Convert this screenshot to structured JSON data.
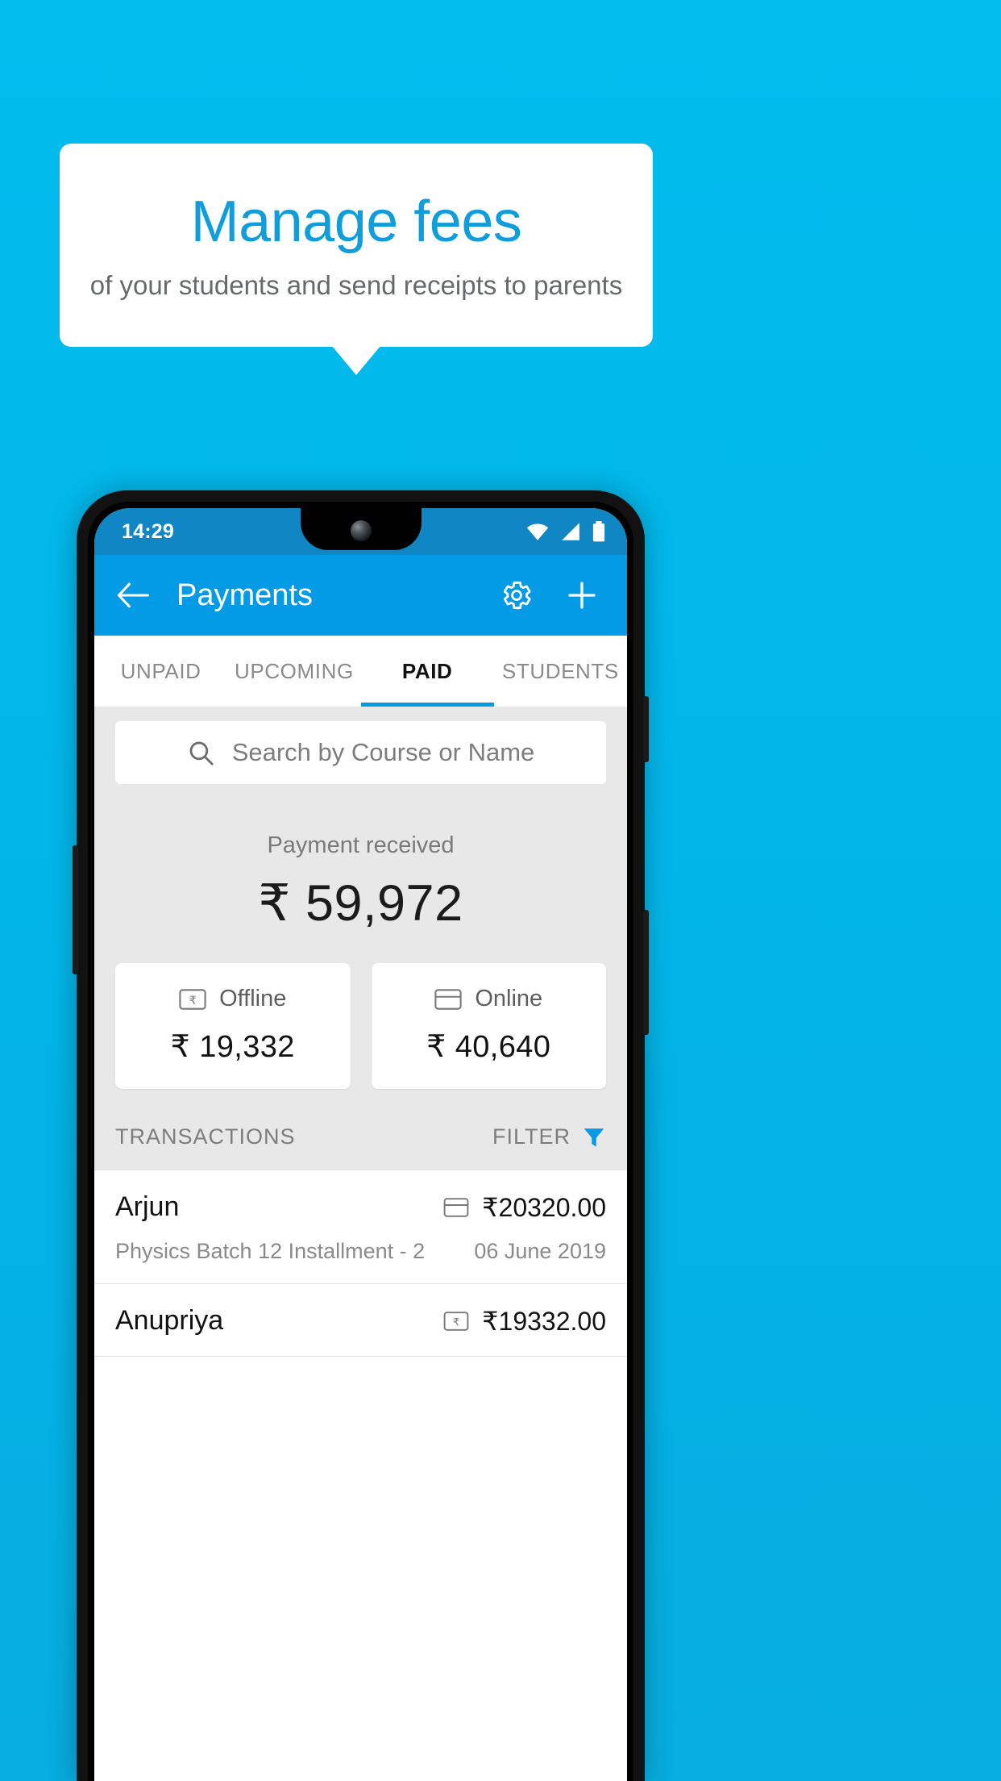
{
  "promo": {
    "title": "Manage fees",
    "subtitle": "of your students and send receipts to parents",
    "background_color": "#02b8ec",
    "title_color": "#0f9edb"
  },
  "phone": {
    "status_bar": {
      "time": "14:29",
      "icons": [
        "wifi-icon",
        "signal-icon",
        "battery-icon"
      ],
      "background_color": "#1186c4"
    },
    "app_bar": {
      "back_label": "back-arrow-icon",
      "title": "Payments",
      "settings_label": "gear-icon",
      "add_label": "plus-icon",
      "background_color": "#039be5"
    },
    "tabs": [
      {
        "label": "UNPAID",
        "active": false
      },
      {
        "label": "UPCOMING",
        "active": false
      },
      {
        "label": "PAID",
        "active": true
      },
      {
        "label": "STUDENTS",
        "active": false
      }
    ],
    "search": {
      "placeholder": "Search by Course or Name",
      "value": "",
      "icon": "search-icon"
    },
    "summary": {
      "label": "Payment received",
      "amount": "₹ 59,972"
    },
    "breakdown": [
      {
        "title": "Offline",
        "value": "₹ 19,332",
        "icon": "banknote-rupee-icon"
      },
      {
        "title": "Online",
        "value": "₹ 40,640",
        "icon": "credit-card-icon"
      }
    ],
    "transactions_header": {
      "title": "TRANSACTIONS",
      "filter_label": "FILTER",
      "filter_icon": "funnel-icon",
      "filter_icon_color": "#039be5"
    },
    "transactions": [
      {
        "name": "Arjun",
        "course": "Physics Batch 12 Installment - 2",
        "amount": "₹20320.00",
        "date": "06 June 2019",
        "method_icon": "credit-card-icon"
      },
      {
        "name": "Anupriya",
        "course": "",
        "amount": "₹19332.00",
        "date": "",
        "method_icon": "banknote-rupee-icon"
      }
    ]
  }
}
